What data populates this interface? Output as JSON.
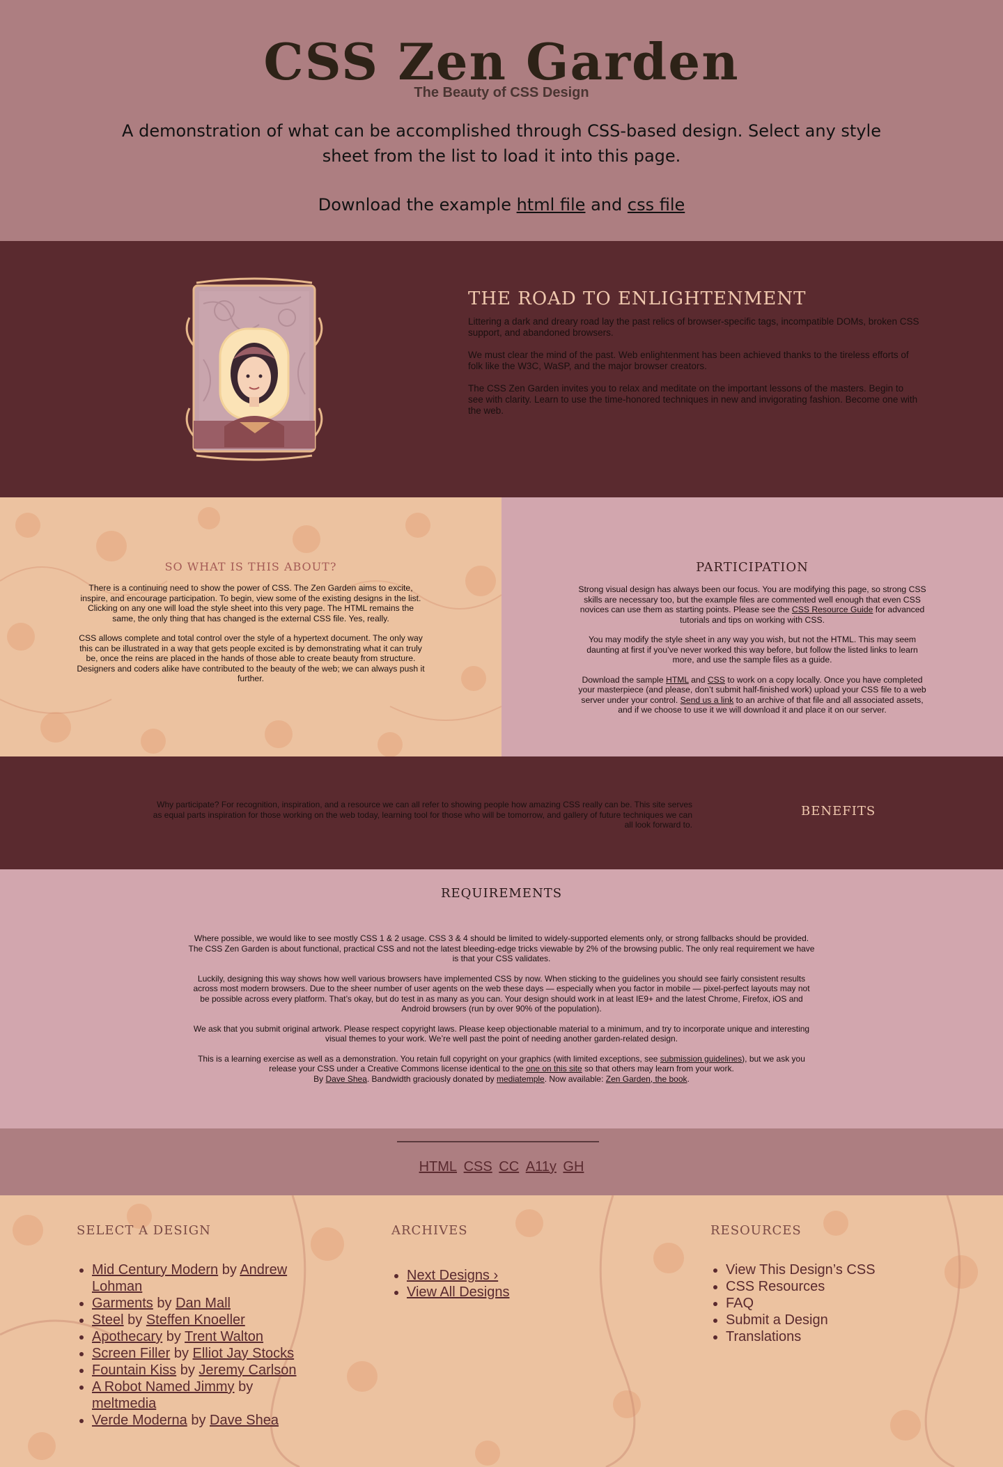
{
  "header": {
    "title": "CSS Zen Garden",
    "subtitle": "The Beauty of CSS Design",
    "summary": "A demonstration of what can be accomplished through CSS-based design. Select any style sheet from the list to load it into this page.",
    "download_prefix": "Download the example ",
    "html_link": "html file",
    "download_and": " and ",
    "css_link": "css file"
  },
  "preamble": {
    "title": "The Road to Enlightenment",
    "paragraphs": [
      "Littering a dark and dreary road lay the past relics of browser-specific tags, incompatible DOMs, broken CSS support, and abandoned browsers.",
      "We must clear the mind of the past. Web enlightenment has been achieved thanks to the tireless efforts of folk like the W3C, WaSP, and the major browser creators.",
      "The CSS Zen Garden invites you to relax and meditate on the important lessons of the masters. Begin to see with clarity. Learn to use the time-honored techniques in new and invigorating fashion. Become one with the web."
    ]
  },
  "explanation": {
    "title": "So What is This About?",
    "paragraphs": [
      "There is a continuing need to show the power of CSS. The Zen Garden aims to excite, inspire, and encourage participation. To begin, view some of the existing designs in the list. Clicking on any one will load the style sheet into this very page. The HTML remains the same, the only thing that has changed is the external CSS file. Yes, really.",
      "CSS allows complete and total control over the style of a hypertext document. The only way this can be illustrated in a way that gets people excited is by demonstrating what it can truly be, once the reins are placed in the hands of those able to create beauty from structure. Designers and coders alike have contributed to the beauty of the web; we can always push it further."
    ]
  },
  "participation": {
    "title": "Participation",
    "p1_before": "Strong visual design has always been our focus. You are modifying this page, so strong CSS skills are necessary too, but the example files are commented well enough that even CSS novices can use them as starting points. Please see the ",
    "p1_link": "CSS Resource Guide",
    "p1_after": " for advanced tutorials and tips on working with CSS.",
    "p2": "You may modify the style sheet in any way you wish, but not the HTML. This may seem daunting at first if you’ve never worked this way before, but follow the listed links to learn more, and use the sample files as a guide.",
    "p3_a": "Download the sample ",
    "p3_html": "HTML",
    "p3_and": " and ",
    "p3_css": "CSS",
    "p3_b": " to work on a copy locally. Once you have completed your masterpiece (and please, don’t submit half-finished work) upload your CSS file to a web server under your control. ",
    "p3_link": "Send us a link",
    "p3_c": " to an archive of that file and all associated assets, and if we choose to use it we will download it and place it on our server."
  },
  "benefits": {
    "title": "Benefits",
    "text": "Why participate? For recognition, inspiration, and a resource we can all refer to showing people how amazing CSS really can be. This site serves as equal parts inspiration for those working on the web today, learning tool for those who will be tomorrow, and gallery of future techniques we can all look forward to."
  },
  "requirements": {
    "title": "Requirements",
    "p1": "Where possible, we would like to see mostly CSS 1 & 2 usage. CSS 3 & 4 should be limited to widely-supported elements only, or strong fallbacks should be provided. The CSS Zen Garden is about functional, practical CSS and not the latest bleeding-edge tricks viewable by 2% of the browsing public. The only real requirement we have is that your CSS validates.",
    "p2": "Luckily, designing this way shows how well various browsers have implemented CSS by now. When sticking to the guidelines you should see fairly consistent results across most modern browsers. Due to the sheer number of user agents on the web these days — especially when you factor in mobile — pixel-perfect layouts may not be possible across every platform. That’s okay, but do test in as many as you can. Your design should work in at least IE9+ and the latest Chrome, Firefox, iOS and Android browsers (run by over 90% of the population).",
    "p3": "We ask that you submit original artwork. Please respect copyright laws. Please keep objectionable material to a minimum, and try to incorporate unique and interesting visual themes to your work. We’re well past the point of needing another garden-related design.",
    "p4_a": "This is a learning exercise as well as a demonstration. You retain full copyright on your graphics (with limited exceptions, see ",
    "p4_link1": "submission guidelines",
    "p4_b": "), but we ask you release your CSS under a Creative Commons license identical to the ",
    "p4_link2": "one on this site",
    "p4_c": " so that others may learn from your work.",
    "p5_a": "By ",
    "p5_link1": "Dave Shea",
    "p5_b": ". Bandwidth graciously donated by ",
    "p5_link2": "mediatemple",
    "p5_c": ". Now available: ",
    "p5_link3": "Zen Garden, the book",
    "p5_d": "."
  },
  "footer": {
    "links": [
      "HTML",
      "CSS",
      "CC",
      "A11y",
      "GH"
    ]
  },
  "sidebar": {
    "design_title": "Select a Design",
    "designs": [
      {
        "name": "Mid Century Modern",
        "by": " by ",
        "author": "Andrew Lohman"
      },
      {
        "name": "Garments",
        "by": " by ",
        "author": "Dan Mall"
      },
      {
        "name": "Steel",
        "by": " by ",
        "author": "Steffen Knoeller"
      },
      {
        "name": "Apothecary",
        "by": " by ",
        "author": "Trent Walton"
      },
      {
        "name": "Screen Filler",
        "by": " by ",
        "author": "Elliot Jay Stocks"
      },
      {
        "name": "Fountain Kiss",
        "by": " by ",
        "author": "Jeremy Carlson"
      },
      {
        "name": "A Robot Named Jimmy",
        "by": " by ",
        "author": "meltmedia"
      },
      {
        "name": "Verde Moderna",
        "by": " by ",
        "author": "Dave Shea"
      }
    ],
    "archives_title": "Archives",
    "archives": [
      "Next Designs ›",
      "View All Designs"
    ],
    "resources_title": "Resources",
    "resources": [
      "View This Design’s CSS",
      "CSS Resources",
      "FAQ",
      "Submit a Design",
      "Translations"
    ]
  },
  "colors": {
    "header_bg": "#ad7e81",
    "dark_band": "#5a2a2f",
    "peach": "#ecc2a0",
    "pink": "#d2a6ae",
    "heading_light": "#f0c8ae",
    "link": "#5a2a2f"
  }
}
